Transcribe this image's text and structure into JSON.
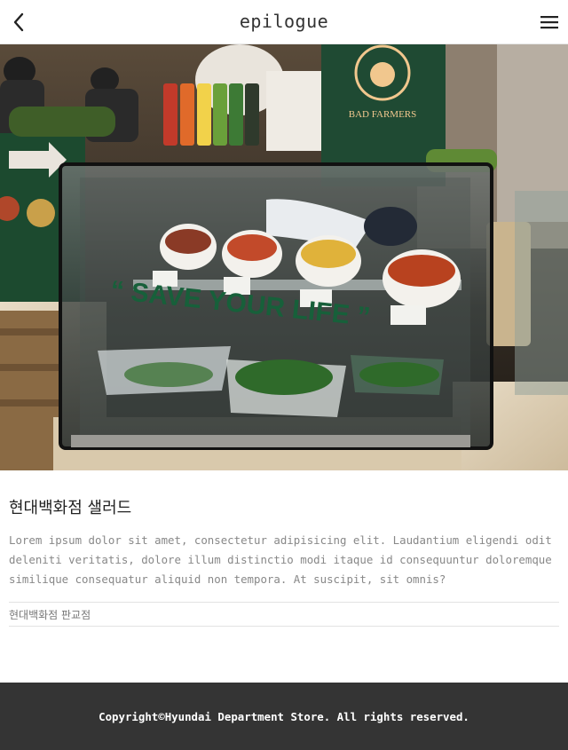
{
  "header": {
    "title": "epilogue",
    "back_icon": "chevron-left-icon",
    "menu_icon": "hamburger-menu-icon"
  },
  "hero": {
    "sign_brand": "BAD FARMERS",
    "glass_text": "“ SAVE YOUR LIFE ”"
  },
  "post": {
    "heading": "현대백화점 샐러드",
    "description": "Lorem ipsum dolor sit amet, consectetur adipisicing elit. Laudantium eligendi odit deleniti veritatis, dolore illum distinctio modi itaque id consequuntur doloremque similique consequatur aliquid non tempora. At suscipit, sit omnis?",
    "location": "현대백화점 판교점"
  },
  "footer": {
    "copyright": "Copyright©Hyundai Department Store. All rights reserved."
  },
  "colors": {
    "footer_bg": "#343434",
    "sign_green": "#1f4a33",
    "text_muted": "#888888"
  }
}
